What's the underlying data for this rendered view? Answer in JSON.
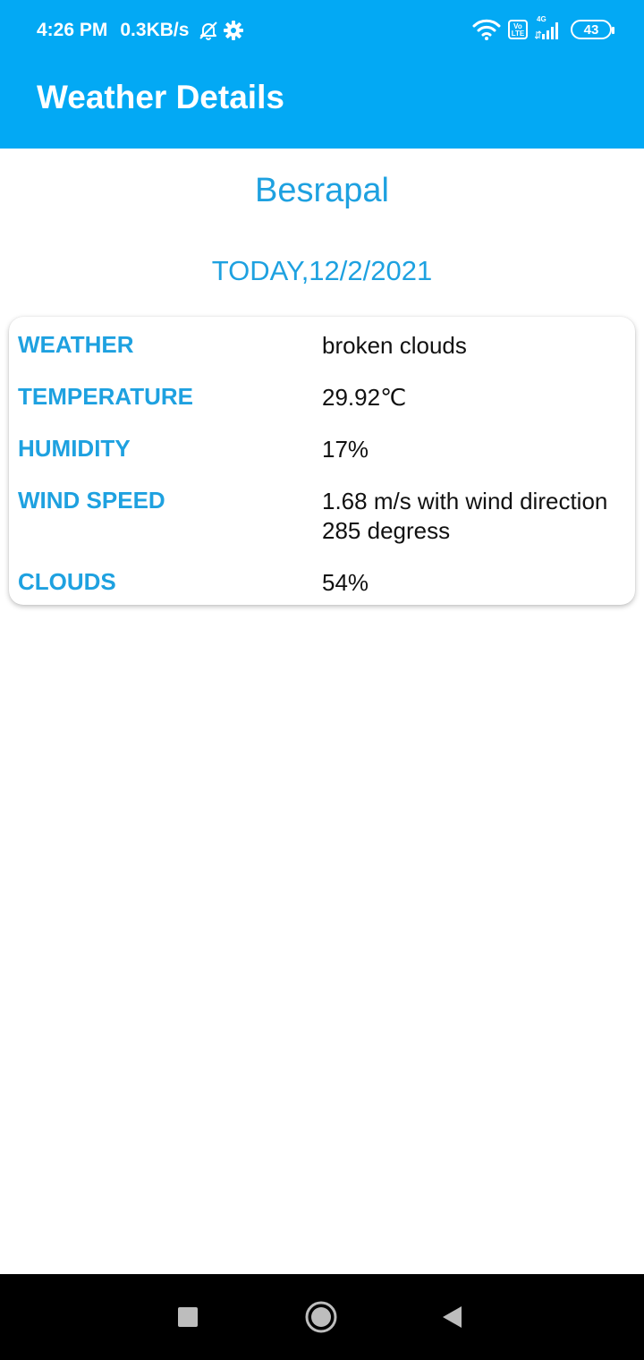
{
  "status_bar": {
    "time": "4:26 PM",
    "net_speed": "0.3KB/s",
    "battery": "43",
    "volte_label": "Vo LTE",
    "network_type": "4G",
    "icons": [
      "mute-bell-icon",
      "gear-icon",
      "wifi-icon",
      "volte-icon",
      "signal-icon",
      "battery-icon"
    ]
  },
  "app_bar": {
    "title": "Weather Details",
    "color": "#03A9F4"
  },
  "location": {
    "city": "Besrapal",
    "date": "TODAY,12/2/2021"
  },
  "weather": {
    "rows": [
      {
        "label": "WEATHER",
        "value": "broken clouds"
      },
      {
        "label": "TEMPERATURE",
        "value": "29.92℃"
      },
      {
        "label": "HUMIDITY",
        "value": "17%"
      },
      {
        "label": "WIND SPEED",
        "value": "1.68 m/s with wind direction 285 degress"
      },
      {
        "label": "CLOUDS",
        "value": "54%"
      }
    ]
  },
  "navigation": {
    "icons": [
      "recents-square-icon",
      "home-circle-icon",
      "back-triangle-icon"
    ]
  },
  "colors": {
    "accent": "#1EA1E0",
    "text": "#111111",
    "nav_bg": "#000000"
  }
}
